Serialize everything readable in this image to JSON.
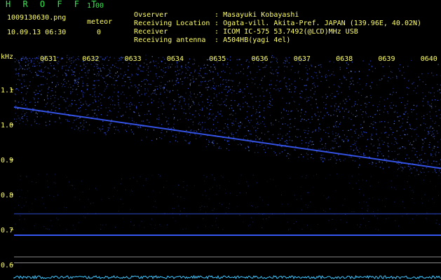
{
  "header": {
    "app_title": "H R O F F T",
    "app_version": "1.00",
    "file_name": "1009130630.png",
    "datetime": "10.09.13 06:30",
    "meteor_label": "meteor",
    "meteor_count": "0",
    "info": [
      {
        "key": "Ovserver",
        "value": ": Masayuki Kobayashi"
      },
      {
        "key": "Receiving Location",
        "value": ": Ogata-vill. Akita-Pref. JAPAN (139.96E, 40.02N)"
      },
      {
        "key": "Receiver",
        "value": ": ICOM IC-575 53.7492(@LCD)MHz USB"
      },
      {
        "key": "Receiving antenna",
        "value": ": A504HB(yagi 4el)"
      }
    ]
  },
  "chart_data": {
    "type": "heatmap",
    "ylabel": "kHz",
    "y_ticks": [
      "1.1",
      "1.0",
      "0.9",
      "0.8",
      "0.7",
      "0.6"
    ],
    "x_ticks": [
      "0631",
      "0632",
      "0633",
      "0634",
      "0635",
      "0636",
      "0637",
      "0638",
      "0639",
      "0640"
    ],
    "ylim": [
      0.58,
      1.2
    ],
    "colors": {
      "background": "#000000",
      "signal": "#3a5cff",
      "bright_signal": "#8fb0ff",
      "noise_floor": "#39c6ff",
      "reference_line": "#888888",
      "label": "#ffff66"
    },
    "features": [
      {
        "kind": "drifting_carrier",
        "start_khz": 1.05,
        "end_khz": 0.875
      },
      {
        "kind": "steady_carrier",
        "khz": 0.745
      },
      {
        "kind": "steady_carrier",
        "khz": 0.684
      },
      {
        "kind": "reference_line",
        "khz": 0.622
      },
      {
        "kind": "reference_line",
        "khz": 0.605
      }
    ]
  }
}
